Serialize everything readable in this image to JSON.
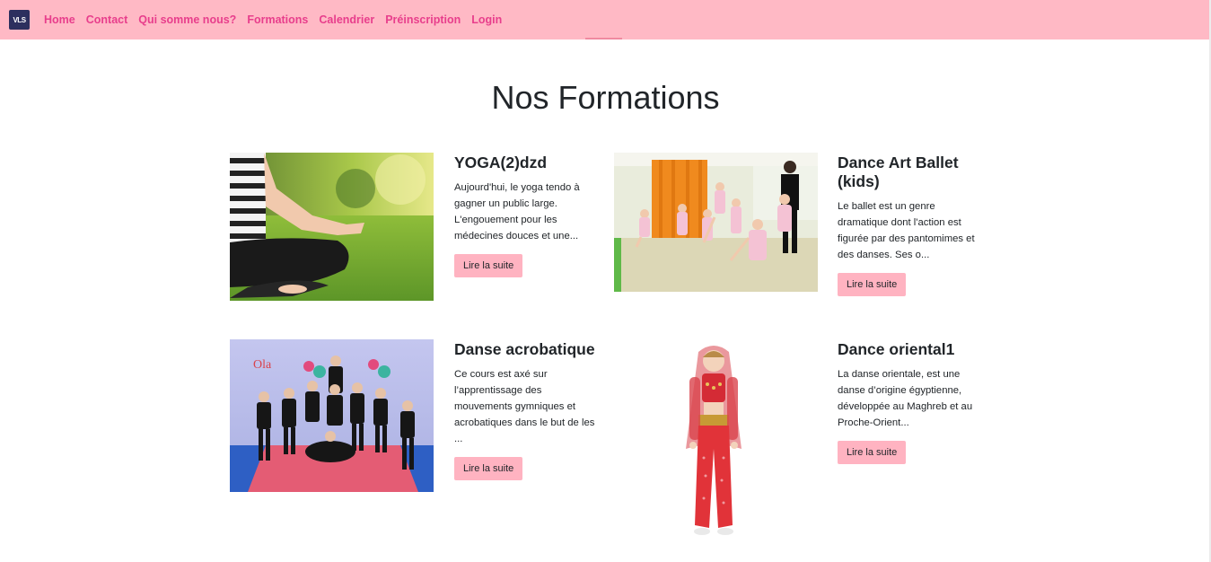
{
  "nav": {
    "logo_text": "VLS",
    "items": [
      {
        "label": "Home"
      },
      {
        "label": "Contact"
      },
      {
        "label": "Qui somme nous?"
      },
      {
        "label": "Formations"
      },
      {
        "label": "Calendrier"
      },
      {
        "label": "Préinscription"
      },
      {
        "label": "Login"
      }
    ]
  },
  "page": {
    "title": "Nos Formations"
  },
  "formations": [
    {
      "title": "YOGA(2)dzd",
      "text": "Aujourd'hui, le yoga tendo à gagner un public large. L'engouement pour les médecines douces et une...",
      "button": "Lire la suite"
    },
    {
      "title": "Dance Art Ballet (kids)",
      "text": "Le ballet est un genre dramatique dont l'action est figurée par des pantomimes et des danses. Ses o...",
      "button": "Lire la suite"
    },
    {
      "title": "Danse acrobatique",
      "text": "Ce cours est axé sur l’apprentissage des mouvements gymniques et acrobatiques dans le but de les ...",
      "button": "Lire la suite"
    },
    {
      "title": "Dance oriental1",
      "text": "La danse orientale, est une danse d’origine égyptienne, développée au Maghreb et au Proche-Orient...",
      "button": "Lire la suite"
    }
  ],
  "colors": {
    "navbar": "#ffb9c5",
    "nav_link": "#e83e8c",
    "button": "#ffb3c1"
  }
}
